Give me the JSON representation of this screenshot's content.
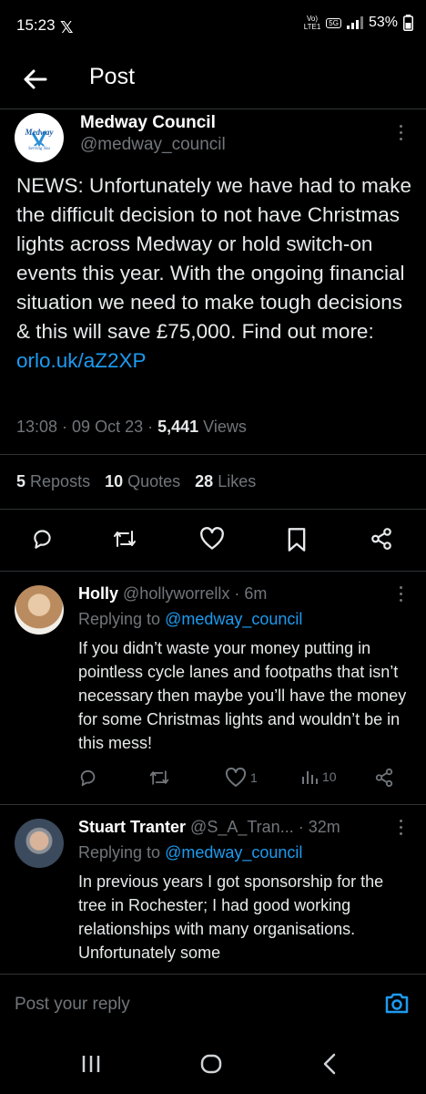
{
  "status": {
    "time": "15:23",
    "net_top": "Vo)",
    "net_bottom": "LTE1",
    "net_type": "5G",
    "battery": "53%"
  },
  "header": {
    "title": "Post"
  },
  "post": {
    "author": "Medway Council",
    "handle": "@medway_council",
    "logo_top": "Medway",
    "logo_bottom": "Serving You",
    "text": "NEWS: Unfortunately we have had to make the difficult decision to not have Christmas lights across Medway or hold switch-on events this year. With the ongoing financial situation we need to make tough decisions & this will save £75,000. Find out more: ",
    "link": "orlo.uk/aZ2XP",
    "time": "13:08",
    "date": "09 Oct 23",
    "views": "5,441",
    "views_label": "Views",
    "reposts": "5",
    "reposts_label": "Reposts",
    "quotes": "10",
    "quotes_label": "Quotes",
    "likes": "28",
    "likes_label": "Likes"
  },
  "replies": [
    {
      "name": "Holly",
      "handle": "@hollyworrellx",
      "age": "6m",
      "replying_prefix": "Replying to",
      "replying_to": "@medway_council",
      "text": "If you didn’t waste your money putting in pointless cycle lanes and footpaths that isn’t necessary then maybe you’ll have the money for some Christmas lights and wouldn’t be in this mess!",
      "likes": "1",
      "views": "10"
    },
    {
      "name": "Stuart Tranter",
      "handle": "@S_A_Tran...",
      "age": "32m",
      "replying_prefix": "Replying to",
      "replying_to": "@medway_council",
      "text": "In previous years I got sponsorship for the tree in Rochester; I had good working relationships with many organisations. Unfortunately some"
    }
  ],
  "compose": {
    "placeholder": "Post your reply"
  },
  "colors": {
    "accent": "#1d9bf0",
    "muted": "#71767b",
    "background": "#000000"
  }
}
